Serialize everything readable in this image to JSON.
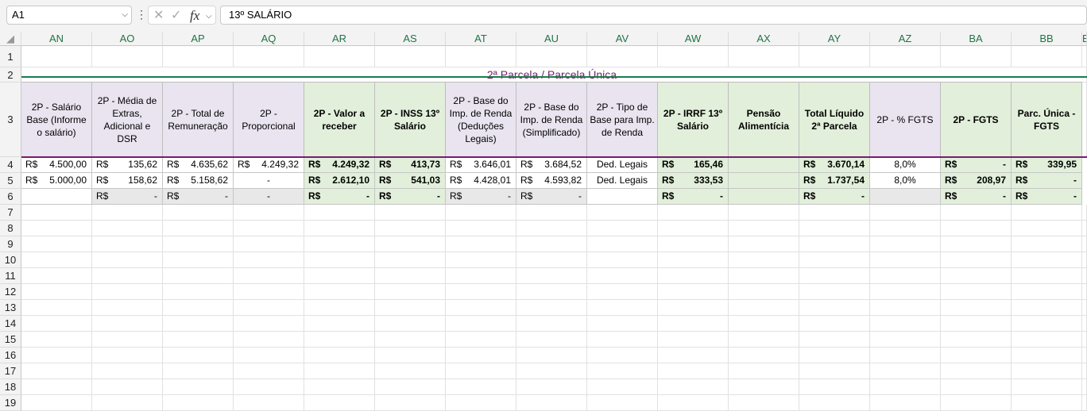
{
  "formula_bar": {
    "name_box": "A1",
    "formula": "13º SALÁRIO",
    "more_icon": "vertical-ellipsis-icon",
    "cancel_icon": "x-icon",
    "confirm_icon": "check-icon",
    "fx_label": "fx"
  },
  "columns": [
    "AN",
    "AO",
    "AP",
    "AQ",
    "AR",
    "AS",
    "AT",
    "AU",
    "AV",
    "AW",
    "AX",
    "AY",
    "AZ",
    "BA",
    "BB",
    "B"
  ],
  "rows": [
    "1",
    "2",
    "3",
    "4",
    "5",
    "6",
    "7",
    "8",
    "9",
    "10",
    "11",
    "12",
    "13",
    "14",
    "15",
    "16",
    "17",
    "18",
    "19"
  ],
  "section_title": "2ª Parcela / Parcela Única",
  "headers": [
    "2P - Salário Base (Informe o salário)",
    "2P - Média de Extras, Adicional e DSR",
    "2P - Total de Remuneração",
    "2P - Proporcional",
    "2P - Valor a receber",
    "2P - INSS 13º Salário",
    "2P - Base do Imp. de Renda (Deduções Legais)",
    "2P - Base do Imp. de Renda (Simplificado)",
    "2P - Tipo de Base para Imp. de Renda",
    "2P - IRRF 13º Salário",
    "Pensão Alimentícia",
    "Total Líquido 2ª Parcela",
    "2P - % FGTS",
    "2P - FGTS",
    "Parc. Única - FGTS"
  ],
  "data_rows": [
    [
      {
        "cur": "R$",
        "val": "4.500,00"
      },
      {
        "cur": "R$",
        "val": "135,62"
      },
      {
        "cur": "R$",
        "val": "4.635,62"
      },
      {
        "cur": "R$",
        "val": "4.249,32"
      },
      {
        "cur": "R$",
        "val": "4.249,32"
      },
      {
        "cur": "R$",
        "val": "413,73"
      },
      {
        "cur": "R$",
        "val": "3.646,01"
      },
      {
        "cur": "R$",
        "val": "3.684,52"
      },
      {
        "cur": "",
        "val": "Ded. Legais"
      },
      {
        "cur": "R$",
        "val": "165,46"
      },
      {
        "cur": "",
        "val": ""
      },
      {
        "cur": "R$",
        "val": "3.670,14"
      },
      {
        "cur": "",
        "val": "8,0%"
      },
      {
        "cur": "R$",
        "val": "-"
      },
      {
        "cur": "R$",
        "val": "339,95"
      }
    ],
    [
      {
        "cur": "R$",
        "val": "5.000,00"
      },
      {
        "cur": "R$",
        "val": "158,62"
      },
      {
        "cur": "R$",
        "val": "5.158,62"
      },
      {
        "cur": "",
        "val": "-"
      },
      {
        "cur": "R$",
        "val": "2.612,10"
      },
      {
        "cur": "R$",
        "val": "541,03"
      },
      {
        "cur": "R$",
        "val": "4.428,01"
      },
      {
        "cur": "R$",
        "val": "4.593,82"
      },
      {
        "cur": "",
        "val": "Ded. Legais"
      },
      {
        "cur": "R$",
        "val": "333,53"
      },
      {
        "cur": "",
        "val": ""
      },
      {
        "cur": "R$",
        "val": "1.737,54"
      },
      {
        "cur": "",
        "val": "8,0%"
      },
      {
        "cur": "R$",
        "val": "208,97"
      },
      {
        "cur": "R$",
        "val": "-"
      }
    ],
    [
      {
        "cur": "",
        "val": ""
      },
      {
        "cur": "R$",
        "val": "-"
      },
      {
        "cur": "R$",
        "val": "-"
      },
      {
        "cur": "",
        "val": "-"
      },
      {
        "cur": "R$",
        "val": "-"
      },
      {
        "cur": "R$",
        "val": "-"
      },
      {
        "cur": "R$",
        "val": "-"
      },
      {
        "cur": "R$",
        "val": "-"
      },
      {
        "cur": "",
        "val": ""
      },
      {
        "cur": "R$",
        "val": "-"
      },
      {
        "cur": "",
        "val": ""
      },
      {
        "cur": "R$",
        "val": "-"
      },
      {
        "cur": "",
        "val": ""
      },
      {
        "cur": "R$",
        "val": "-"
      },
      {
        "cur": "R$",
        "val": "-"
      }
    ]
  ],
  "colors": {
    "header_accent": "#217346",
    "title_color": "#7a1b6f",
    "lavender_fill": "#e9e4f0",
    "green_fill": "#e2efda",
    "gray_fill": "#e8e8e8",
    "band_line": "#1a7c4a",
    "purple_line": "#7a1b6f"
  }
}
